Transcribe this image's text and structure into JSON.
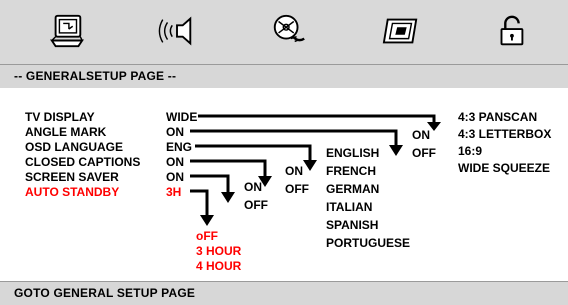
{
  "toolbar": {
    "icons": [
      {
        "name": "general-setup-icon"
      },
      {
        "name": "audio-setup-icon"
      },
      {
        "name": "dolby-setup-icon"
      },
      {
        "name": "video-setup-icon"
      },
      {
        "name": "preference-lock-icon"
      }
    ]
  },
  "page_title": "-- GENERALSETUP PAGE --",
  "menu": {
    "items": [
      {
        "label": "TV DISPLAY",
        "value": "WIDE"
      },
      {
        "label": "ANGLE MARK",
        "value": "ON"
      },
      {
        "label": "OSD LANGUAGE",
        "value": "ENG"
      },
      {
        "label": "CLOSED CAPTIONS",
        "value": "ON"
      },
      {
        "label": "SCREEN SAVER",
        "value": "ON"
      },
      {
        "label": "AUTO STANDBY",
        "value": "3H"
      }
    ]
  },
  "options": {
    "tv_display": [
      "4:3 PANSCAN",
      "4:3 LETTERBOX",
      "16:9",
      "WIDE SQUEEZE"
    ],
    "angle_mark": [
      "ON",
      "OFF"
    ],
    "osd_language": [
      "ENGLISH",
      "FRENCH",
      "GERMAN",
      "ITALIAN",
      "SPANISH",
      "PORTUGUESE"
    ],
    "closed_captions": [
      "ON",
      "OFF"
    ],
    "screen_saver": [
      "ON",
      "OFF"
    ],
    "auto_standby": [
      "oFF",
      "3 HOUR",
      "4 HOUR"
    ]
  },
  "footer": "GOTO GENERAL SETUP PAGE",
  "colors": {
    "highlight": "#ff0000",
    "bar": "#d7d7d7",
    "text": "#000000"
  }
}
